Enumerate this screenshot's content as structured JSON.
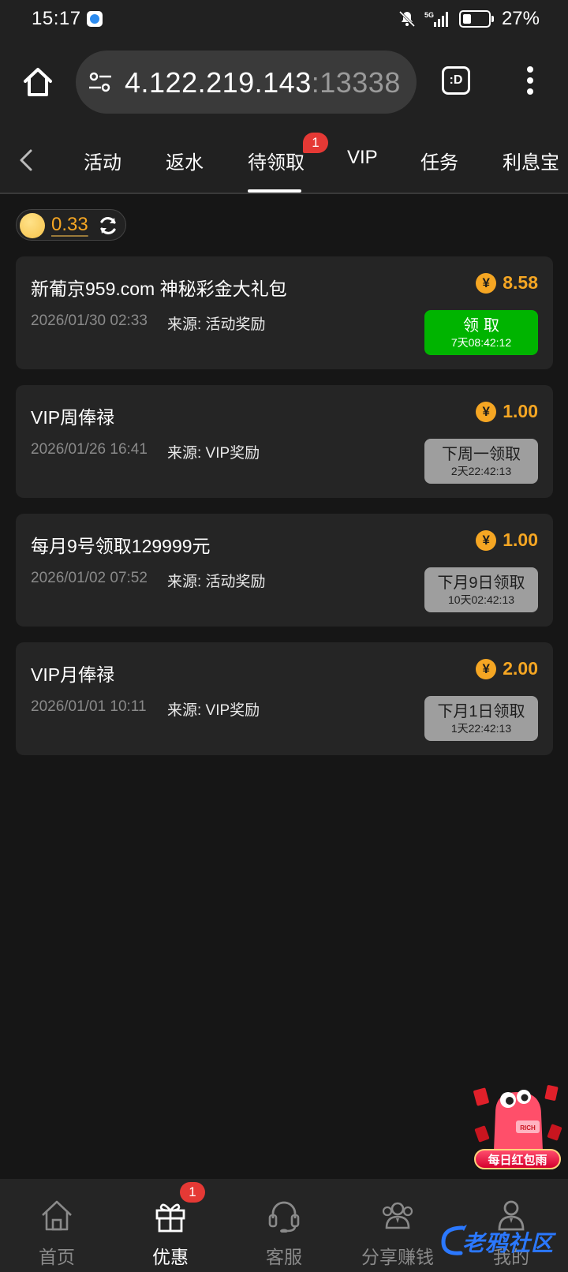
{
  "status_bar": {
    "time": "15:17",
    "battery": "27%",
    "network": "5G"
  },
  "browser": {
    "url_host": "4.122.219.143",
    "url_port": ":13338",
    "tab_count": ":D"
  },
  "tabs": {
    "items": [
      "活动",
      "返水",
      "待领取",
      "VIP",
      "任务",
      "利息宝"
    ],
    "active": "待领取",
    "badge": "1"
  },
  "balance": {
    "value": "0.33"
  },
  "cards": [
    {
      "title": "新葡京959.com 神秘彩金大礼包",
      "date": "2026/01/30 02:33",
      "source": "来源: 活动奖励",
      "amount": "8.58",
      "button_label": "领取",
      "button_timer": "7天08:42:12",
      "button_state": "available"
    },
    {
      "title": "VIP周俸禄",
      "date": "2026/01/26 16:41",
      "source": "来源: VIP奖励",
      "amount": "1.00",
      "button_label": "下周一领取",
      "button_timer": "2天22:42:13",
      "button_state": "disabled"
    },
    {
      "title": "每月9号领取129999元",
      "date": "2026/01/02 07:52",
      "source": "来源: 活动奖励",
      "amount": "1.00",
      "button_label": "下月9日领取",
      "button_timer": "10天02:42:13",
      "button_state": "disabled"
    },
    {
      "title": "VIP月俸禄",
      "date": "2026/01/01 10:11",
      "source": "来源: VIP奖励",
      "amount": "2.00",
      "button_label": "下月1日领取",
      "button_timer": "1天22:42:13",
      "button_state": "disabled"
    }
  ],
  "currency_symbol": "¥",
  "promo": {
    "label": "每日红包雨"
  },
  "bottom_nav": {
    "items": [
      "首页",
      "优惠",
      "客服",
      "分享赚钱",
      "我的"
    ],
    "active": "优惠",
    "badge": "1"
  },
  "watermark": "老鸦社区",
  "colors": {
    "accent_gold": "#f5a623",
    "claim_green": "#00b400",
    "badge_red": "#e53935",
    "background": "#161616",
    "card": "#252525"
  }
}
